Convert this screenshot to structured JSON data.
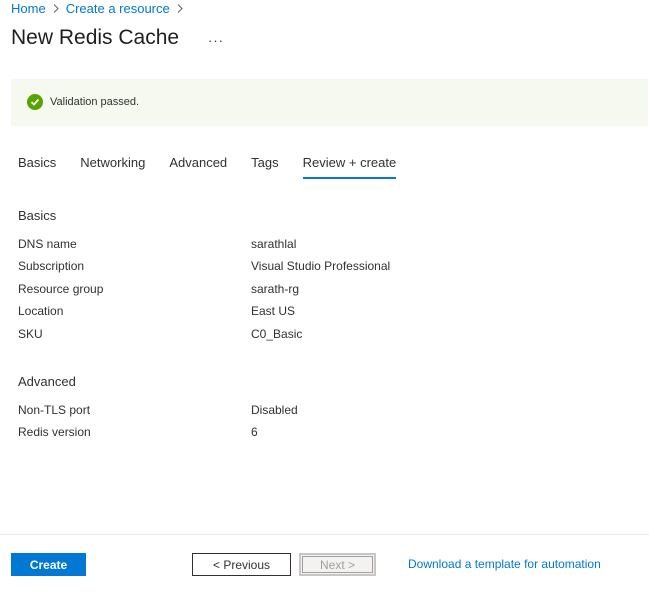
{
  "breadcrumb": [
    {
      "label": "Home"
    },
    {
      "label": "Create a resource"
    }
  ],
  "page_title": "New Redis Cache",
  "more_label": "···",
  "validation": {
    "message": "Validation passed.",
    "status_color": "#57a300"
  },
  "tabs": [
    {
      "label": "Basics"
    },
    {
      "label": "Networking"
    },
    {
      "label": "Advanced"
    },
    {
      "label": "Tags"
    },
    {
      "label": "Review + create",
      "active": true
    }
  ],
  "basics": {
    "heading": "Basics",
    "rows": [
      {
        "label": "DNS name",
        "value": "sarathlal"
      },
      {
        "label": "Subscription",
        "value": "Visual Studio Professional"
      },
      {
        "label": "Resource group",
        "value": "sarath-rg"
      },
      {
        "label": "Location",
        "value": "East US"
      },
      {
        "label": "SKU",
        "value": "C0_Basic"
      }
    ]
  },
  "advanced": {
    "heading": "Advanced",
    "rows": [
      {
        "label": "Non-TLS port",
        "value": "Disabled"
      },
      {
        "label": "Redis version",
        "value": "6"
      }
    ]
  },
  "footer": {
    "create_label": "Create",
    "previous_label": "< Previous",
    "next_label": "Next >",
    "download_label": "Download a template for automation"
  },
  "colors": {
    "accent": "#0078d4",
    "banner_bg": "#f5f9f0"
  },
  "icons": {
    "chevron": "chevron-right-icon",
    "success": "checkmark-circle-icon"
  }
}
